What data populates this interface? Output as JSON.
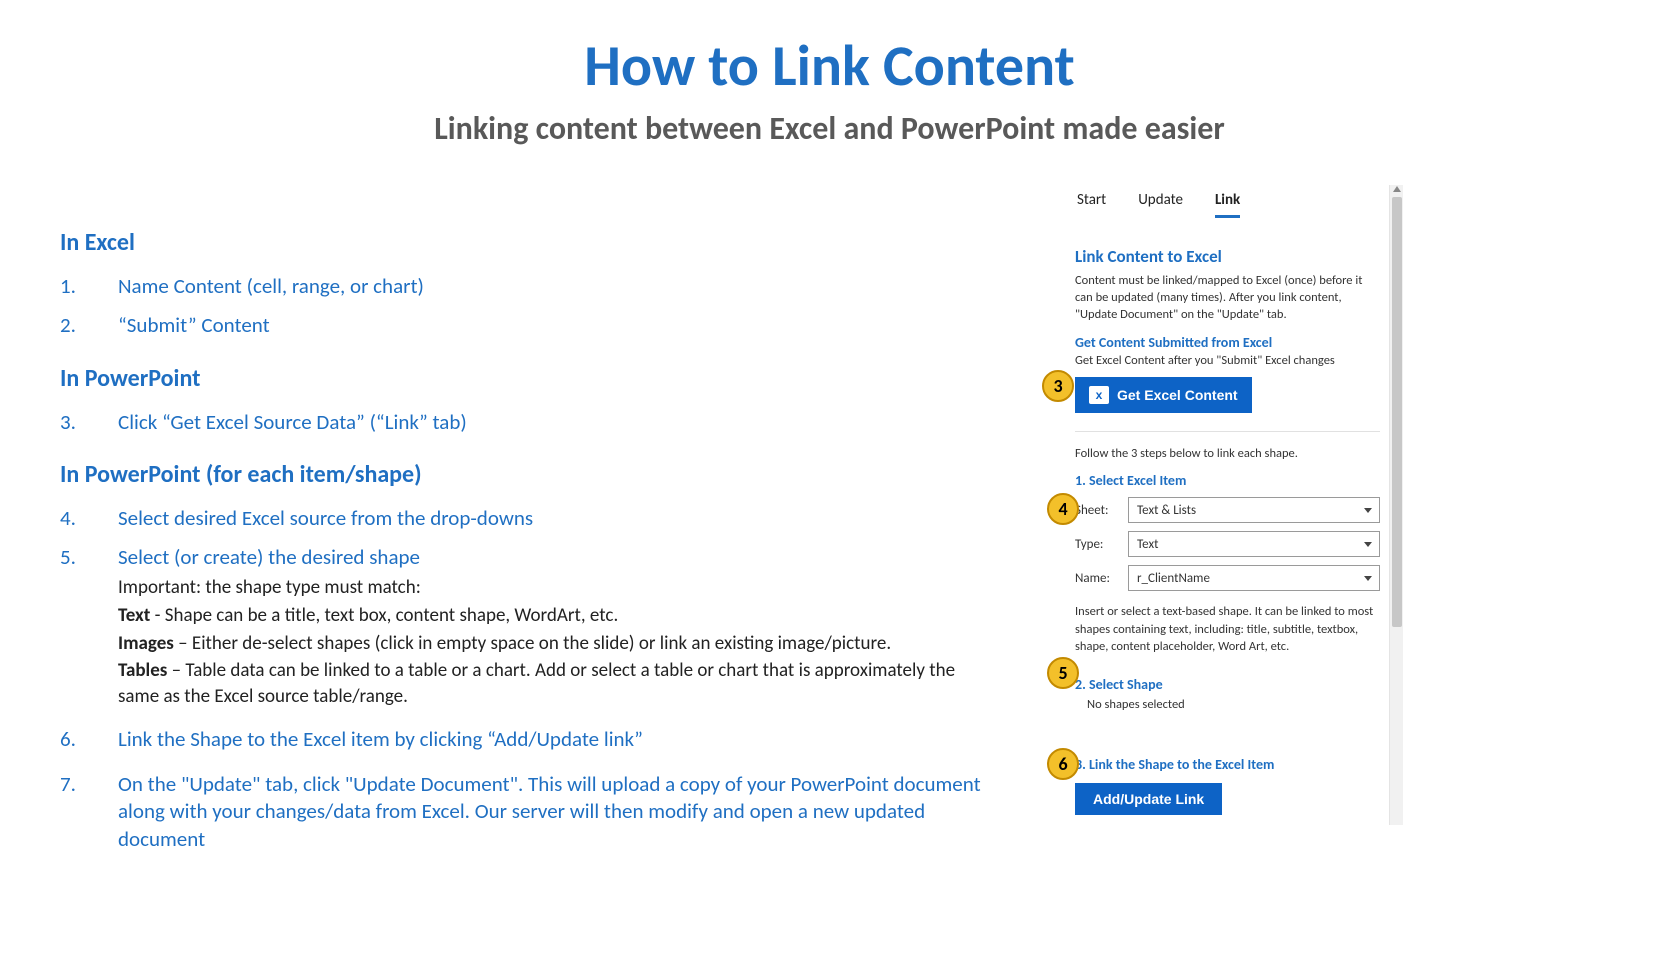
{
  "title": "How to Link Content",
  "subtitle": "Linking content between Excel and PowerPoint made easier",
  "left": {
    "sec1": "In Excel",
    "s1n1": "1.",
    "s1t1": "Name Content (cell, range, or chart)",
    "s1n2": "2.",
    "s1t2": "“Submit” Content",
    "sec2": "In PowerPoint",
    "s2n3": "3.",
    "s2t3": "Click “Get Excel Source Data” (“Link” tab)",
    "sec3": "In PowerPoint (for each item/shape)",
    "s3n4": "4.",
    "s3t4": "Select desired Excel source from the drop-downs",
    "s3n5": "5.",
    "s3t5": "Select (or create) the desired shape",
    "sub5a": "Important: the shape type must match:",
    "sub5b_b": "Text",
    "sub5b_t": " - Shape can be a title, text box, content shape, WordArt, etc.",
    "sub5c_b": "Images",
    "sub5c_t": " – Either de-select shapes (click in empty space on the slide) or link an existing image/picture.",
    "sub5d_b": "Tables",
    "sub5d_t": " – Table data can be linked to a table or a chart. Add or select a table or chart that is approximately the same as the Excel source table/range.",
    "s3n6": "6.",
    "s3t6": "Link the Shape to the Excel item by clicking “Add/Update link”",
    "s3n7": "7.",
    "s3t7": "On the \"Update\" tab, click \"Update Document\". This will upload a copy of your PowerPoint document along with your changes/data from Excel. Our server will then modify and open a new updated document"
  },
  "pane": {
    "tabs": {
      "start": "Start",
      "update": "Update",
      "link": "Link"
    },
    "title": "Link Content to Excel",
    "desc": "Content must be linked/mapped to Excel (once) before it can be updated (many times). After you link content, \"Update Document\" on the \"Update\" tab.",
    "get_title": "Get Content Submitted from Excel",
    "get_desc": "Get Excel Content after you \"Submit\" Excel changes",
    "btn_get": "Get Excel Content",
    "follow": "Follow the 3 steps below to link each shape.",
    "step1": "1. Select Excel Item",
    "sheet_label": "Sheet:",
    "sheet_val": "Text & Lists",
    "type_label": "Type:",
    "type_val": "Text",
    "name_label": "Name:",
    "name_val": "r_ClientName",
    "help": "Insert or select a text-based shape. It can be linked to most shapes containing text, including: title, subtitle, textbox, shape, content placeholder, Word Art, etc.",
    "step2": "2. Select Shape",
    "step2_sub": "No shapes selected",
    "step3": "3. Link the Shape to the Excel Item",
    "btn_link": "Add/Update Link"
  },
  "callouts": {
    "c3": "3",
    "c4": "4",
    "c5": "5",
    "c6": "6"
  }
}
